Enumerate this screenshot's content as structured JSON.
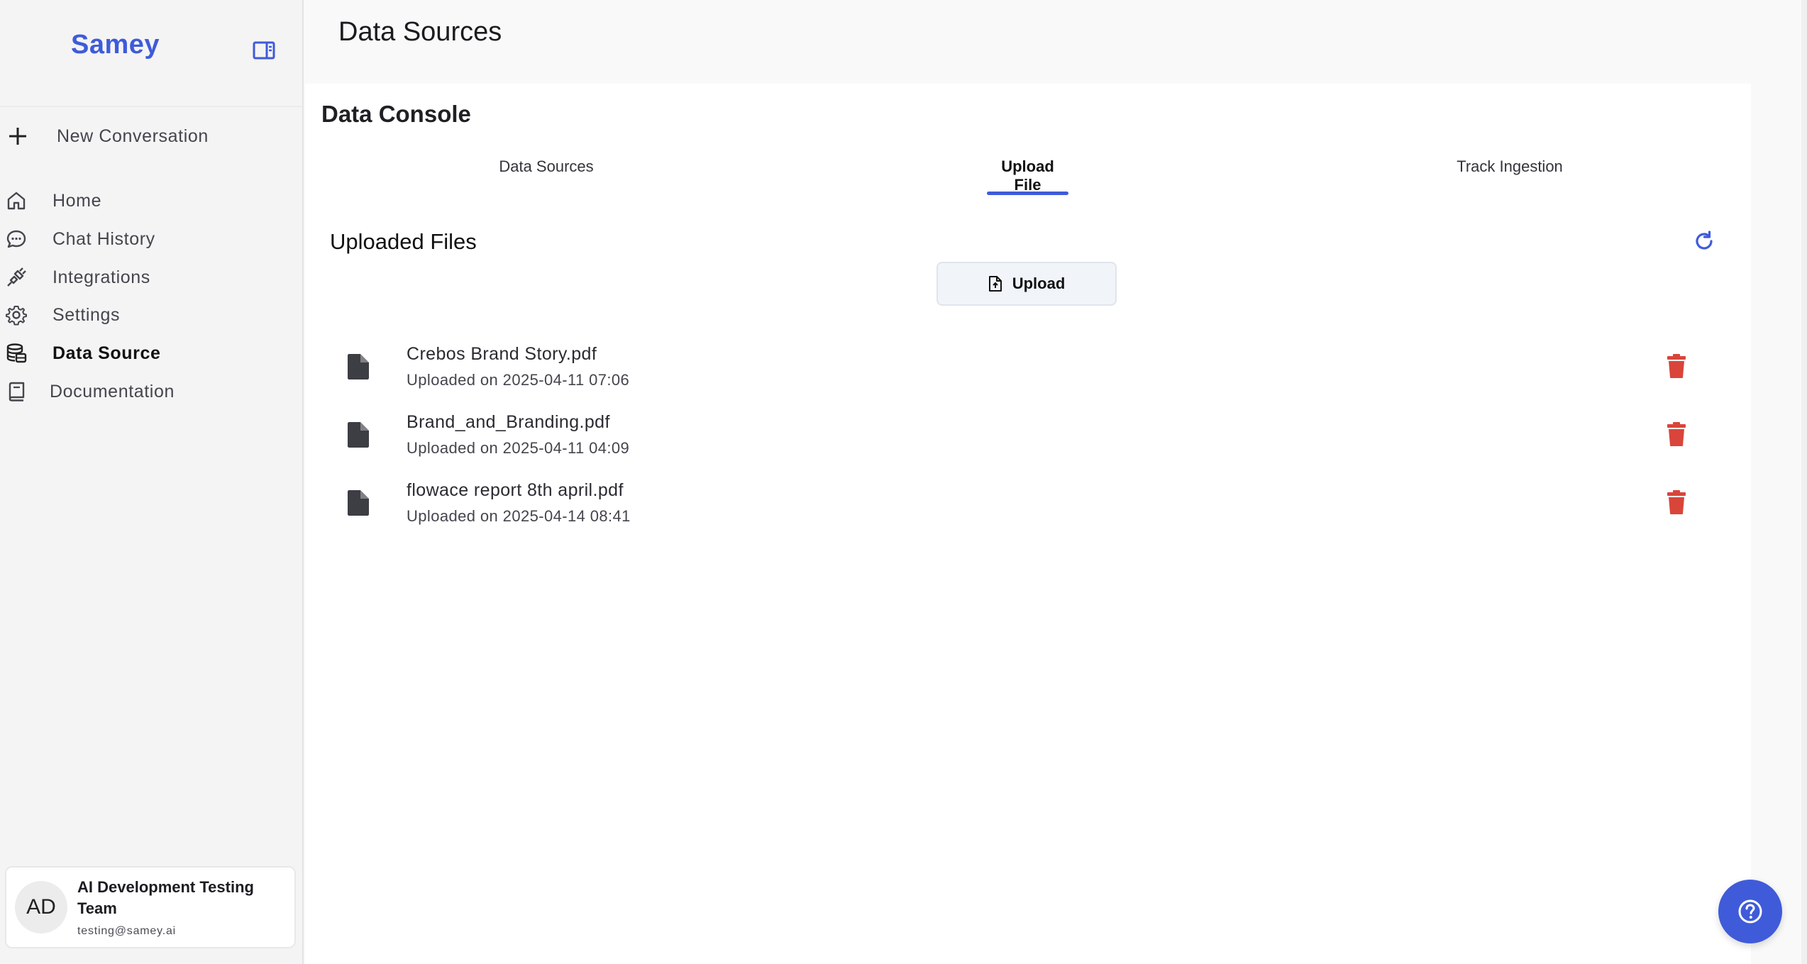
{
  "app": {
    "brand": "Samey",
    "page_title": "Data Sources",
    "accent_color": "#3f5bd9",
    "danger_color": "#d9453a"
  },
  "sidebar": {
    "new_conversation": "New Conversation",
    "items": [
      {
        "label": "Home",
        "icon": "home-icon",
        "active": false
      },
      {
        "label": "Chat History",
        "icon": "chat-bubble-icon",
        "active": false
      },
      {
        "label": "Integrations",
        "icon": "plug-icon",
        "active": false
      },
      {
        "label": "Settings",
        "icon": "gear-icon",
        "active": false
      },
      {
        "label": "Data Source",
        "icon": "database-icon",
        "active": true
      },
      {
        "label": "Documentation",
        "icon": "book-icon",
        "active": false
      }
    ],
    "user": {
      "initials": "AD",
      "name": "AI Development Testing Team",
      "email": "testing@samey.ai"
    }
  },
  "console": {
    "title": "Data Console",
    "tabs": [
      {
        "label": "Data Sources",
        "active": false
      },
      {
        "label": "Upload File",
        "active": true
      },
      {
        "label": "Track Ingestion",
        "active": false
      }
    ],
    "section_title": "Uploaded Files",
    "upload_label": "Upload",
    "files": [
      {
        "name": "Crebos Brand Story.pdf",
        "uploaded": "Uploaded on 2025-04-11 07:06"
      },
      {
        "name": "Brand_and_Branding.pdf",
        "uploaded": "Uploaded on 2025-04-11 04:09"
      },
      {
        "name": "flowace report 8th april.pdf",
        "uploaded": "Uploaded on 2025-04-14 08:41"
      }
    ]
  }
}
